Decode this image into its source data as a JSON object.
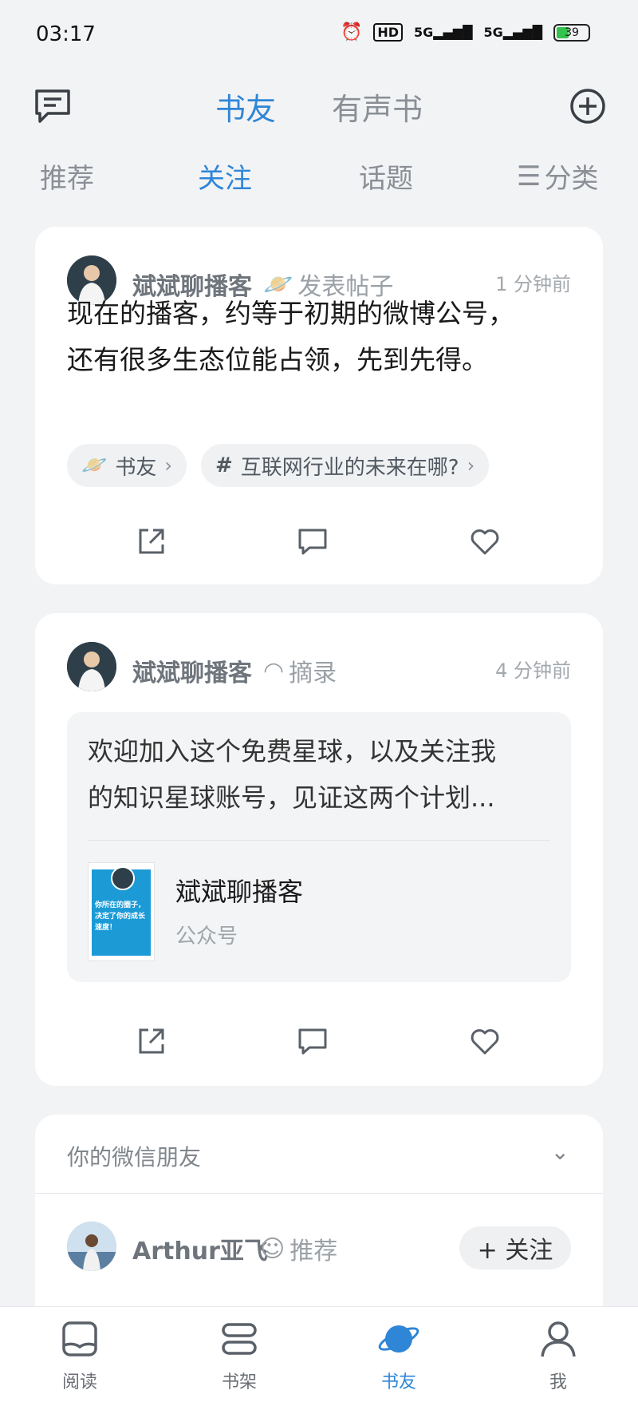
{
  "status_bar": {
    "time": "03:17",
    "hd_label": "HD",
    "net1": "5G",
    "net2": "5G",
    "battery": "39",
    "battery_level": 0.39
  },
  "top_nav": {
    "tabs": [
      {
        "label": "书友",
        "active": true
      },
      {
        "label": "有声书",
        "active": false
      }
    ]
  },
  "sub_nav": {
    "tabs": [
      {
        "label": "推荐",
        "active": false
      },
      {
        "label": "关注",
        "active": true
      },
      {
        "label": "话题",
        "active": false
      }
    ],
    "category_label": "分类"
  },
  "posts": [
    {
      "user": "斌斌聊播客",
      "type": "发表帖子",
      "time": "1 分钟前",
      "text_line1": "现在的播客，约等于初期的微博公号，",
      "text_line2": "还有很多生态位能占领，先到先得。",
      "chips": [
        {
          "icon": "planet-icon",
          "label": "书友"
        },
        {
          "icon": "hash-icon",
          "label": "互联网行业的未来在哪?"
        }
      ]
    },
    {
      "user": "斌斌聊播客",
      "type": "摘录",
      "time": "4 分钟前",
      "excerpt_line1": "欢迎加入这个免费星球，以及关注我",
      "excerpt_line2": "的知识星球账号，见证这两个计划...",
      "linked": {
        "name": "斌斌聊播客",
        "kind": "公众号",
        "thumb_text": "你所在的圈子，决定了你的成长速度！"
      }
    }
  ],
  "friends_section": {
    "title": "你的微信朋友",
    "user": "Arthur亚飞",
    "tag": "推荐",
    "follow_label": "+ 关注"
  },
  "bottom_nav": {
    "items": [
      {
        "label": "阅读",
        "icon": "book-icon",
        "active": false
      },
      {
        "label": "书架",
        "icon": "shelf-icon",
        "active": false
      },
      {
        "label": "书友",
        "icon": "planet-icon",
        "active": true
      },
      {
        "label": "我",
        "icon": "person-icon",
        "active": false
      }
    ]
  },
  "colors": {
    "accent": "#2f86d6",
    "background": "#f2f3f5",
    "muted": "#8a8f96"
  }
}
